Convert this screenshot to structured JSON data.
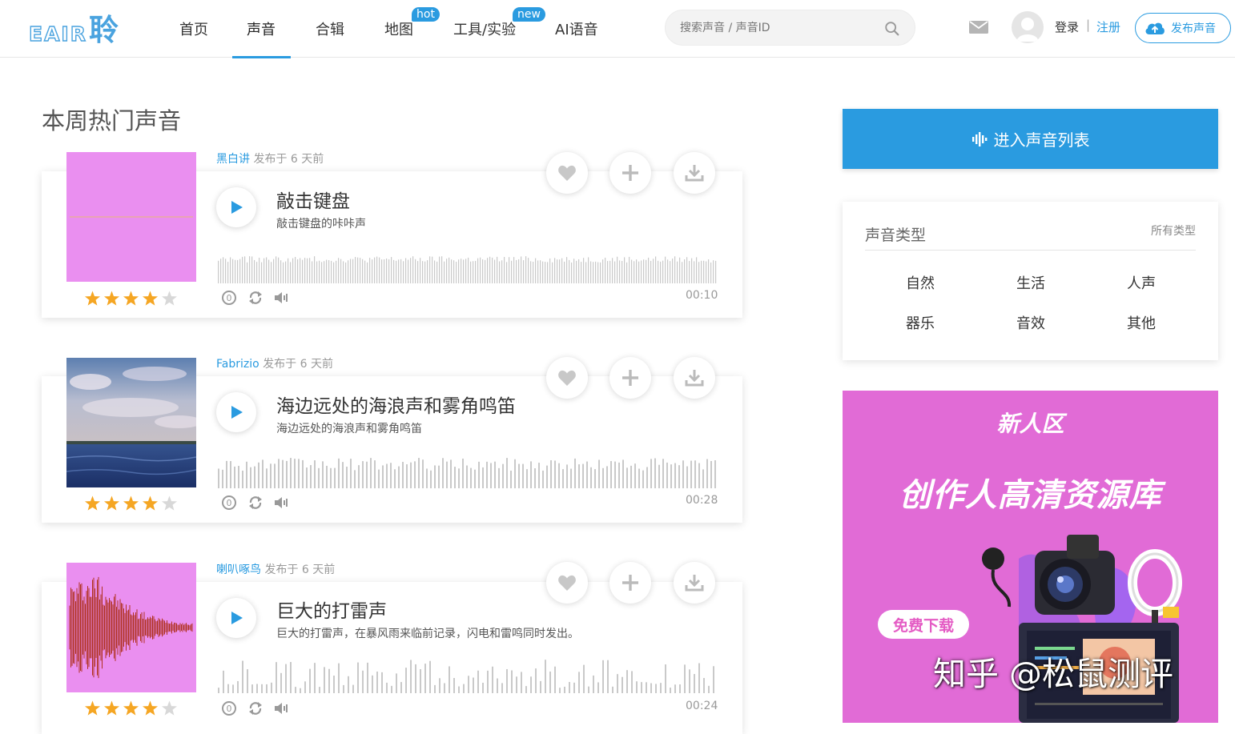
{
  "header": {
    "logo_latin": "EAIR",
    "logo_cn": "聆",
    "nav": [
      {
        "label": "首页",
        "badge": ""
      },
      {
        "label": "声音",
        "badge": ""
      },
      {
        "label": "合辑",
        "badge": ""
      },
      {
        "label": "地图",
        "badge": "hot"
      },
      {
        "label": "工具/实验",
        "badge": "new"
      },
      {
        "label": "AI语音",
        "badge": ""
      }
    ],
    "active_nav": "声音",
    "search_placeholder": "搜索声音 / 声音ID",
    "login": "登录",
    "separator": "|",
    "register": "注册",
    "publish": "发布声音"
  },
  "main": {
    "section_title": "本周热门声音",
    "tracks": [
      {
        "author": "黑白讲",
        "published": "发布于 6 天前",
        "title": "敲击键盘",
        "description": "敲击键盘的咔咔声",
        "duration": "00:10",
        "rating": 4,
        "thumb": "pink"
      },
      {
        "author": "Fabrizio",
        "published": "发布于 6 天前",
        "title": "海边远处的海浪声和雾角鸣笛",
        "description": "海边远处的海浪声和雾角鸣笛",
        "duration": "00:28",
        "rating": 4,
        "thumb": "sea"
      },
      {
        "author": "喇叭啄鸟",
        "published": "发布于 6 天前",
        "title": "巨大的打雷声",
        "description": "巨大的打雷声，在暴风雨来临前记录，闪电和雷鸣同时发出。",
        "duration": "00:24",
        "rating": 4,
        "thumb": "thunder"
      }
    ]
  },
  "sidebar": {
    "enter_list": "进入声音列表",
    "types_title": "声音类型",
    "types_all": "所有类型",
    "types": [
      "自然",
      "生活",
      "人声",
      "器乐",
      "音效",
      "其他"
    ]
  },
  "banner": {
    "small_title": "新人区",
    "big_title": "创作人高清资源库",
    "tag": "免费下载"
  },
  "watermark": "知乎 @松鼠测评",
  "colors": {
    "accent": "#2a9be0",
    "star": "#f5a623",
    "banner_bg": "#e16bd6"
  }
}
